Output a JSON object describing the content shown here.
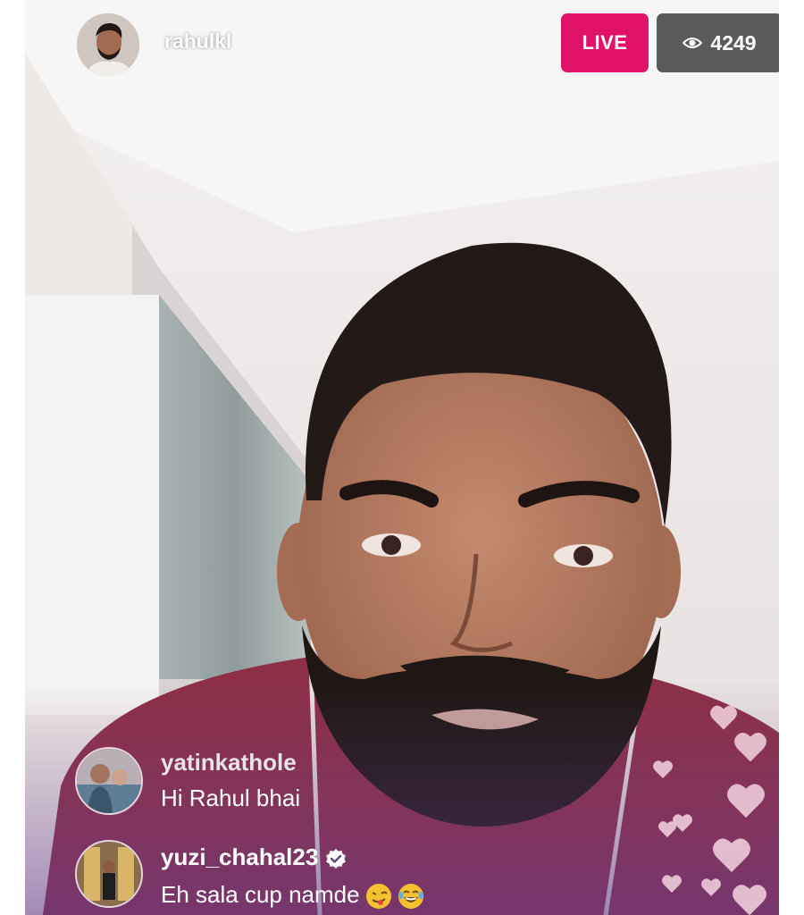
{
  "header": {
    "host_username": "rahulkl",
    "live_label": "LIVE",
    "viewer_count": "4249",
    "eye_icon": "eye-icon"
  },
  "comments": [
    {
      "username": "yatinkathole",
      "text": "Hi Rahul bhai",
      "verified": false
    },
    {
      "username": "yuzi_chahal23",
      "text": "Eh sala cup namde",
      "verified": true,
      "emojis": [
        "wink-tongue-emoji",
        "laughing-tears-emoji"
      ]
    }
  ],
  "reactions": {
    "icon": "heart-icon",
    "color": "#f4d3e1"
  },
  "colors": {
    "live": "#e0126a",
    "viewer_badge": "#5b5a5c",
    "jersey": "#8c2f47"
  }
}
